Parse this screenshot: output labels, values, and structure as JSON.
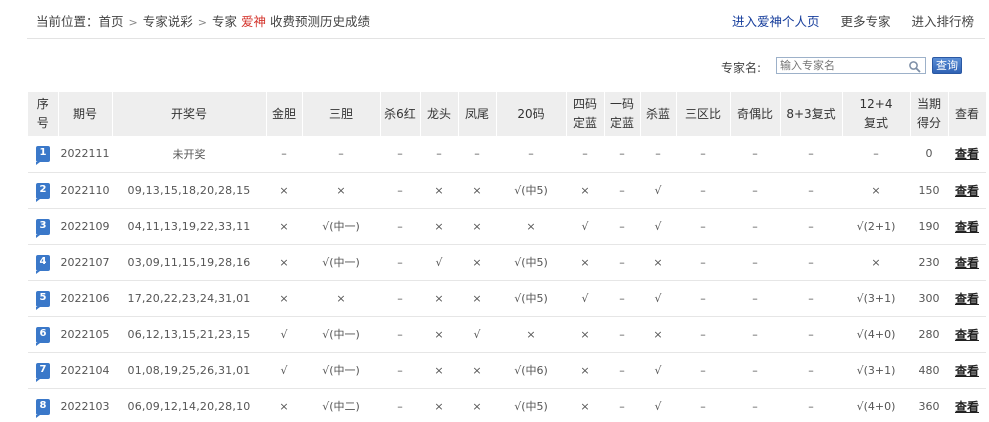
{
  "breadcrumb": {
    "prefix": "当前位置：",
    "home": "首页",
    "section": "专家说彩",
    "expert_prefix": "专家",
    "expert_name": "爱神",
    "page": "收费预测历史成绩",
    "separator": ">"
  },
  "top_links": [
    "进入爱神个人页",
    "更多专家",
    "进入排行榜"
  ],
  "search": {
    "label": "专家名:",
    "placeholder": "输入专家名",
    "button": "查询"
  },
  "colors": {
    "accent_red": "#d4352d",
    "link_blue": "#173e9c",
    "badge_blue": "#3a78c9"
  },
  "table": {
    "headers": [
      [
        "序",
        "号"
      ],
      [
        "期号"
      ],
      [
        "开奖号"
      ],
      [
        "金胆"
      ],
      [
        "三胆"
      ],
      [
        "杀6红"
      ],
      [
        "龙头"
      ],
      [
        "凤尾"
      ],
      [
        "20码"
      ],
      [
        "四码",
        "定蓝"
      ],
      [
        "一码",
        "定蓝"
      ],
      [
        "杀蓝"
      ],
      [
        "三区比"
      ],
      [
        "奇偶比"
      ],
      [
        "8+3复式"
      ],
      [
        "12+4",
        "复式"
      ],
      [
        "当期",
        "得分"
      ],
      [
        "查看"
      ]
    ],
    "rows": [
      [
        "1",
        "2022111",
        "未开奖",
        "–",
        "–",
        "–",
        "–",
        "–",
        "–",
        "–",
        "–",
        "–",
        "–",
        "–",
        "–",
        "–",
        "0",
        "查看"
      ],
      [
        "2",
        "2022110",
        "09,13,15,18,20,28,15",
        "×",
        "×",
        "–",
        "×",
        "×",
        "√(中5)",
        "×",
        "–",
        "√",
        "–",
        "–",
        "–",
        "×",
        "150",
        "查看"
      ],
      [
        "3",
        "2022109",
        "04,11,13,19,22,33,11",
        "×",
        "√(中一)",
        "–",
        "×",
        "×",
        "×",
        "√",
        "–",
        "√",
        "–",
        "–",
        "–",
        "√(2+1)",
        "190",
        "查看"
      ],
      [
        "4",
        "2022107",
        "03,09,11,15,19,28,16",
        "×",
        "√(中一)",
        "–",
        "√",
        "×",
        "√(中5)",
        "×",
        "–",
        "×",
        "–",
        "–",
        "–",
        "×",
        "230",
        "查看"
      ],
      [
        "5",
        "2022106",
        "17,20,22,23,24,31,01",
        "×",
        "×",
        "–",
        "×",
        "×",
        "√(中5)",
        "√",
        "–",
        "√",
        "–",
        "–",
        "–",
        "√(3+1)",
        "300",
        "查看"
      ],
      [
        "6",
        "2022105",
        "06,12,13,15,21,23,15",
        "√",
        "√(中一)",
        "–",
        "×",
        "√",
        "×",
        "×",
        "–",
        "×",
        "–",
        "–",
        "–",
        "√(4+0)",
        "280",
        "查看"
      ],
      [
        "7",
        "2022104",
        "01,08,19,25,26,31,01",
        "√",
        "√(中一)",
        "–",
        "×",
        "×",
        "√(中6)",
        "×",
        "–",
        "√",
        "–",
        "–",
        "–",
        "√(3+1)",
        "480",
        "查看"
      ],
      [
        "8",
        "2022103",
        "06,09,12,14,20,28,10",
        "×",
        "√(中二)",
        "–",
        "×",
        "×",
        "√(中5)",
        "×",
        "–",
        "√",
        "–",
        "–",
        "–",
        "√(4+0)",
        "360",
        "查看"
      ]
    ]
  }
}
